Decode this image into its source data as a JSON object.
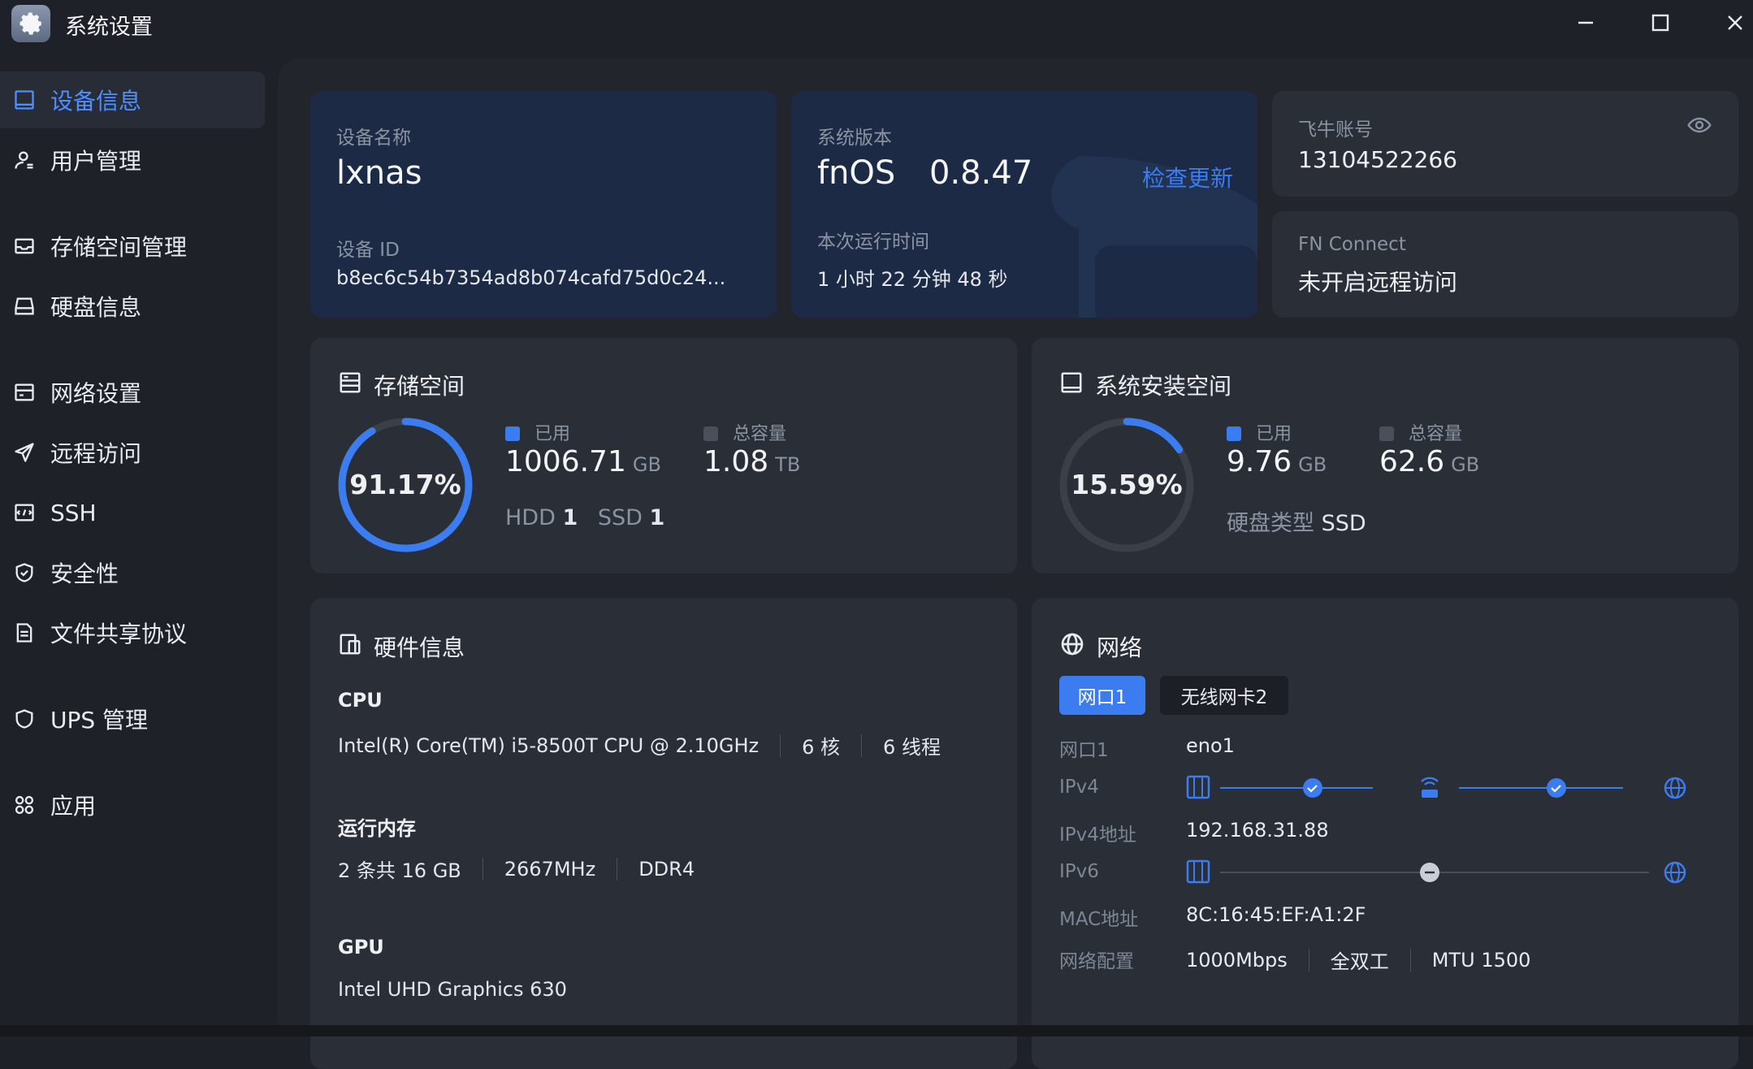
{
  "window": {
    "title": "系统设置",
    "app_icon": "gear-icon",
    "controls": [
      "minimize-icon",
      "maximize-icon",
      "close-icon"
    ]
  },
  "sidebar": {
    "items": [
      {
        "label": "设备信息",
        "icon": "device-icon",
        "active": true
      },
      {
        "label": "用户管理",
        "icon": "user-icon"
      },
      {
        "label": "存储空间管理",
        "icon": "storage-icon"
      },
      {
        "label": "硬盘信息",
        "icon": "disk-icon"
      },
      {
        "label": "网络设置",
        "icon": "network-icon"
      },
      {
        "label": "远程访问",
        "icon": "send-icon"
      },
      {
        "label": "SSH",
        "icon": "terminal-icon"
      },
      {
        "label": "安全性",
        "icon": "shield-icon"
      },
      {
        "label": "文件共享协议",
        "icon": "file-icon"
      },
      {
        "label": "UPS 管理",
        "icon": "ups-shield-icon"
      },
      {
        "label": "应用",
        "icon": "apps-icon"
      }
    ]
  },
  "device": {
    "name_label": "设备名称",
    "name": "lxnas",
    "id_label": "设备 ID",
    "id": "b8ec6c54b7354ad8b074cafd75d0c24..."
  },
  "system": {
    "version_label": "系统版本",
    "os_name": "fnOS",
    "version": "0.8.47",
    "check_update": "检查更新",
    "uptime_label": "本次运行时间",
    "uptime": "1 小时 22 分钟 48 秒"
  },
  "account": {
    "label": "飞牛账号",
    "value": "13104522266",
    "icon": "eye-icon"
  },
  "fn_connect": {
    "label": "FN Connect",
    "value": "未开启远程访问"
  },
  "storage": {
    "title": "存储空间",
    "percent": "91.17%",
    "usage_fraction": 0.9117,
    "used_label": "已用",
    "used_value": "1006.71",
    "used_unit": "GB",
    "total_label": "总容量",
    "total_value": "1.08",
    "total_unit": "TB",
    "hdd_label": "HDD",
    "hdd_count": "1",
    "ssd_label": "SSD",
    "ssd_count": "1"
  },
  "sys_space": {
    "title": "系统安装空间",
    "percent": "15.59%",
    "usage_fraction": 0.1559,
    "used_label": "已用",
    "used_value": "9.76",
    "used_unit": "GB",
    "total_label": "总容量",
    "total_value": "62.6",
    "total_unit": "GB",
    "disk_type_label": "硬盘类型",
    "disk_type": "SSD"
  },
  "hardware": {
    "title": "硬件信息",
    "cpu_title": "CPU",
    "cpu_model": "Intel(R) Core(TM) i5-8500T CPU @ 2.10GHz",
    "cpu_cores": "6 核",
    "cpu_threads": "6 线程",
    "ram_title": "运行内存",
    "ram_size": "2 条共 16 GB",
    "ram_speed": "2667MHz",
    "ram_type": "DDR4",
    "gpu_title": "GPU",
    "gpu_model": "Intel UHD Graphics 630"
  },
  "network": {
    "title": "网络",
    "tabs": [
      {
        "label": "网口1",
        "active": true
      },
      {
        "label": "无线网卡2",
        "active": false
      }
    ],
    "port_label": "网口1",
    "port_value": "eno1",
    "ipv4_label": "IPv4",
    "ipv4_addr_label": "IPv4地址",
    "ipv4_addr": "192.168.31.88",
    "ipv6_label": "IPv6",
    "mac_label": "MAC地址",
    "mac": "8C:16:45:EF:A1:2F",
    "config_label": "网络配置",
    "speed": "1000Mbps",
    "duplex": "全双工",
    "mtu": "MTU 1500"
  },
  "colors": {
    "accent": "#3b7cf0",
    "sidebar_active_text": "#4d8fff",
    "card_bg": "#2a2e36",
    "card_blue_bg": "#1c2a45"
  }
}
